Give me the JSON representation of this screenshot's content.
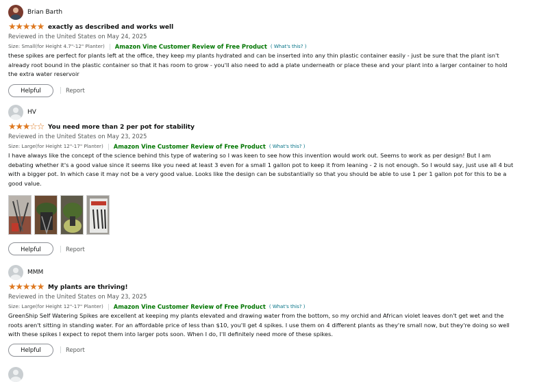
{
  "reviews": [
    {
      "name": "Brian Barth",
      "rating": 5,
      "title": "exactly as described and works well",
      "reviewed": "Reviewed in the United States on May 24, 2025",
      "size": "Size: Small(for Height 4.7\"-12\" Planter)",
      "vine": "Amazon Vine Customer Review of Free Product",
      "whats": "( What's this? )",
      "body": "these spikes are perfect for plants left at the office, they keep my plants hydrated and can be inserted into any thin plastic container easily - just be sure that the plant isn't already root bound in the plastic container so that it has room to grow - you'll also need to add a plate underneath or place these and your plant into a larger container to hold the extra water reservoir",
      "helpful": "Helpful",
      "report": "Report"
    },
    {
      "name": "HV",
      "rating": 3,
      "title": "You need more than 2 per pot for stability",
      "reviewed": "Reviewed in the United States on May 23, 2025",
      "size": "Size: Large(for Height 12\"-17\" Planter)",
      "vine": "Amazon Vine Customer Review of Free Product",
      "whats": "( What's this? )",
      "body": "I have always like the concept of the science behind this type of watering so I was keen to see how this invention would work out. Seems to work as per design! But I am debating whether it's a good value since it seems like you need at least 3 even for a small 1 gallon pot to keep it from leaning - 2 is not enough. So I would say, just use all 4 but with a bigger pot. In which case it may not be a very good value. Looks like the design can be substantially so that you should be able to use 1 per 1 gallon pot for this to be a good value.",
      "helpful": "Helpful",
      "report": "Report"
    },
    {
      "name": "MMM",
      "rating": 5,
      "title": "My plants are thriving!",
      "reviewed": "Reviewed in the United States on May 23, 2025",
      "size": "Size: Large(for Height 12\"-17\" Planter)",
      "vine": "Amazon Vine Customer Review of Free Product",
      "whats": "( What's this? )",
      "body": "GreenShip Self Watering Spikes are excellent at keeping my plants elevated and drawing water from the bottom, so my orchid and African violet leaves don't get wet and the roots aren't sitting in standing water. For an affordable price of less than $10, you'll get 4 spikes. I use them on 4 different plants as they're small now, but they're doing so well with these spikes I expect to repot them into larger pots soon. When I do, I'll definitely need more of these spikes.",
      "helpful": "Helpful",
      "report": "Report"
    }
  ],
  "colors": {
    "star": "#de7921",
    "vine": "#007600",
    "link": "#007185"
  }
}
